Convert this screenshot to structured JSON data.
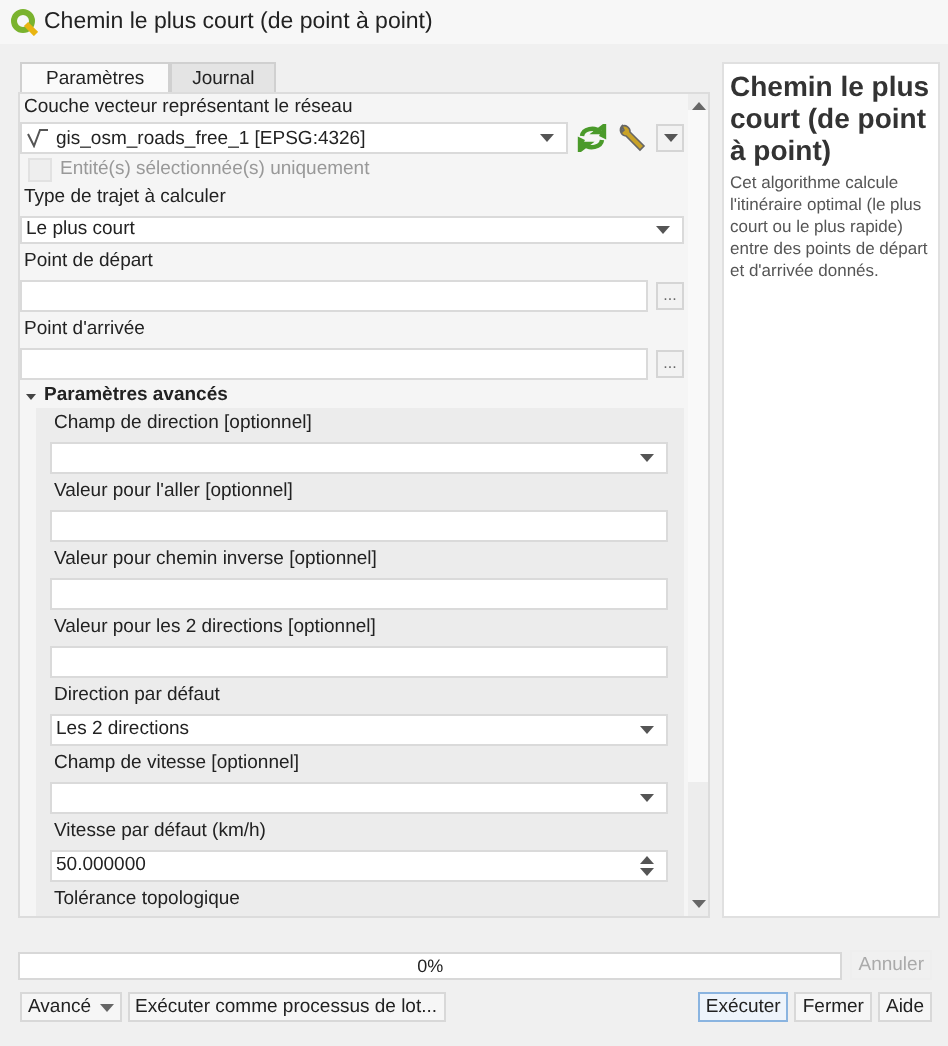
{
  "window": {
    "title": "Chemin le plus court (de point à point)"
  },
  "tabs": [
    {
      "label": "Paramètres",
      "selected": true
    },
    {
      "label": "Journal",
      "selected": false
    }
  ],
  "params": [
    {
      "kind": "label",
      "text": "Couche vecteur représentant le réseau"
    },
    {
      "kind": "layer",
      "value": "gis_osm_roads_free_1 [EPSG:4326]"
    },
    {
      "kind": "checkbox",
      "label": "Entité(s) sélectionnée(s) uniquement",
      "checked": false,
      "disabled": true
    },
    {
      "kind": "label",
      "text": "Type de trajet à calculer"
    },
    {
      "kind": "combo",
      "value": "Le plus court"
    },
    {
      "kind": "label",
      "text": "Point de départ"
    },
    {
      "kind": "file",
      "button": "..."
    },
    {
      "kind": "label",
      "text": "Point d'arrivée"
    },
    {
      "kind": "file",
      "button": "..."
    },
    {
      "kind": "section",
      "title": "Paramètres avancés",
      "expanded": true,
      "children": [
        {
          "kind": "label",
          "text": "Champ de direction [optionnel]"
        },
        {
          "kind": "combo"
        },
        {
          "kind": "label",
          "text": "Valeur pour l'aller [optionnel]"
        },
        {
          "kind": "text"
        },
        {
          "kind": "label",
          "text": "Valeur pour chemin inverse [optionnel]"
        },
        {
          "kind": "text"
        },
        {
          "kind": "label",
          "text": "Valeur pour les 2 directions [optionnel]"
        },
        {
          "kind": "text"
        },
        {
          "kind": "label",
          "text": "Direction par défaut"
        },
        {
          "kind": "combo",
          "value": "Les 2 directions"
        },
        {
          "kind": "label",
          "text": "Champ de vitesse [optionnel]"
        },
        {
          "kind": "combo"
        },
        {
          "kind": "label",
          "text": "Vitesse par défaut (km/h)"
        },
        {
          "kind": "spin",
          "value": "50.000000"
        },
        {
          "kind": "label",
          "text": "Tolérance topologique"
        }
      ]
    }
  ],
  "help": {
    "title": "Chemin le plus court (de point à point)",
    "text": "Cet algorithme calcule l'itinéraire optimal (le plus court ou le plus rapide) entre des points de départ et d'arrivée donnés."
  },
  "progress": {
    "text": "0%",
    "level": 0,
    "cancel": "Annuler",
    "cancel_disabled": true
  },
  "buttons_left": [
    {
      "label": "Avancé",
      "dropdown": true
    },
    {
      "label": "Exécuter comme processus de lot...",
      "dropdown": false
    }
  ],
  "buttons_right": [
    {
      "label": "Exécuter",
      "default": true
    },
    {
      "label": "Fermer",
      "default": false
    },
    {
      "label": "Aide",
      "default": false
    }
  ]
}
